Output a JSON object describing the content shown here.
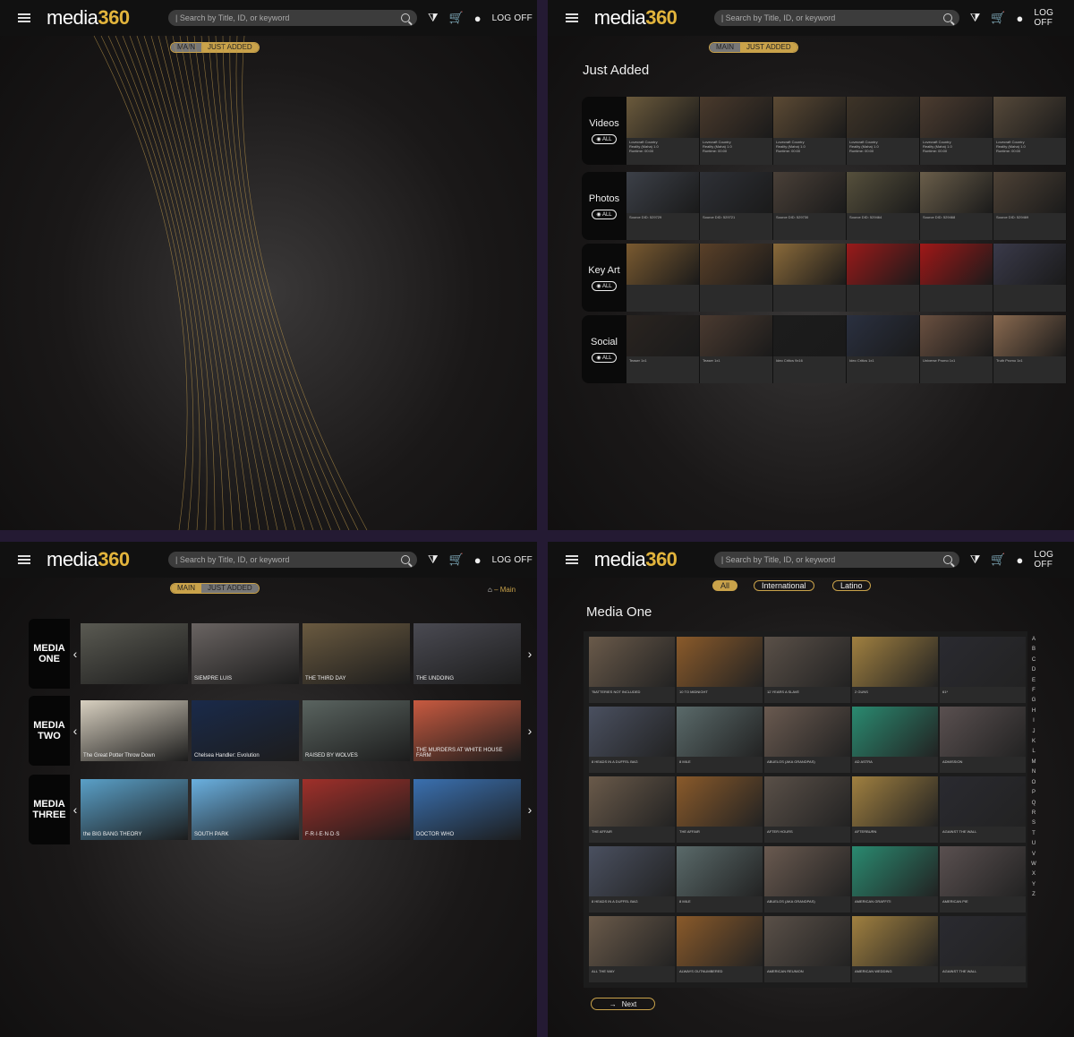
{
  "topbar": {
    "logo_text": "media",
    "logo_num": "360",
    "search_placeholder": "| Search by Title, ID, or keyword",
    "logoff": "LOG OFF"
  },
  "tabs": {
    "main": "MAIN",
    "just_added": "JUST ADDED"
  },
  "just_added": {
    "title": "Just Added",
    "all_label": "ALL",
    "rows": [
      {
        "label": "Videos",
        "items": [
          "Lovecraft Country\nReality (Maha) 1.0\nRuntime: 00:00",
          "Lovecraft Country\nReality (Maha) 1.0\nRuntime: 00:00",
          "Lovecraft Country\nReality (Maha) 1.0\nRuntime: 00:00",
          "Lovecraft Country\nReality (Maha) 1.0\nRuntime: 00:00",
          "Lovecraft Country\nReality (Maha) 1.0\nRuntime: 00:00",
          "Lovecraft Country\nReality (Maha) 1.0\nRuntime: 00:00"
        ]
      },
      {
        "label": "Photos",
        "items": [
          "Source DID: 529729",
          "Source DID: 529721",
          "Source DID: 529730",
          "Source DID: 529464",
          "Source DID: 529468",
          "Source DID: 529469"
        ]
      },
      {
        "label": "Key Art",
        "items": [
          "",
          "",
          "",
          "",
          "",
          ""
        ]
      },
      {
        "label": "Social",
        "items": [
          "Teaser 1x1",
          "Teaser 1x1",
          "Ideo Critics 9x16",
          "Ideo Critics 1x1",
          "Universe Promo 1x1",
          "Truth Promo 1x1"
        ]
      }
    ]
  },
  "main": {
    "breadcrumb": "Main",
    "rows": [
      {
        "label": "MEDIA ONE",
        "tiles": [
          "",
          "SIEMPRE LUIS",
          "THE THIRD DAY",
          "THE UNDOING"
        ]
      },
      {
        "label": "MEDIA TWO",
        "tiles": [
          "The Great Potter Throw Down",
          "Chelsea Handler: Evolution",
          "RAISED BY WOLVES",
          "THE MURDERS AT WHITE HOUSE FARM"
        ]
      },
      {
        "label": "MEDIA THREE",
        "tiles": [
          "the BIG BANG THEORY",
          "SOUTH PARK",
          "F·R·I·E·N·D·S",
          "DOCTOR WHO"
        ]
      }
    ]
  },
  "media_one": {
    "title": "Media One",
    "filters": [
      "All",
      "International",
      "Latino"
    ],
    "grid": [
      "\"BATTERIES NOT INCLUDED",
      "10 TO MIDNIGHT",
      "12 YEARS A SLAVE",
      "2 GUNS",
      "61*",
      "8 HEADS IN A DUFFEL BAG",
      "8 MILE",
      "ABUELOS (AKA GRANDPAS)",
      "AD ASTRA",
      "ADMISSION",
      "THE AFFAIR",
      "THE AFFAIR",
      "AFTER HOURS",
      "AFTERBURN",
      "AGAINST THE WALL",
      "8 HEADS IN A DUFFEL BAG",
      "8 MILE",
      "ABUELOS (AKA GRANDPAS)",
      "AMERICAN GRAFFITI",
      "AMERICAN PIE",
      "ALL THE WAY",
      "ALWAYS OUTNUMBERED",
      "AMERICAN REUNION",
      "AMERICAN WEDDING",
      "AGAINST THE WALL"
    ],
    "alphabet": [
      "A",
      "B",
      "C",
      "D",
      "E",
      "F",
      "G",
      "H",
      "I",
      "J",
      "K",
      "L",
      "M",
      "N",
      "O",
      "P",
      "Q",
      "R",
      "S",
      "T",
      "U",
      "V",
      "W",
      "X",
      "Y",
      "Z"
    ],
    "next": "Next"
  }
}
